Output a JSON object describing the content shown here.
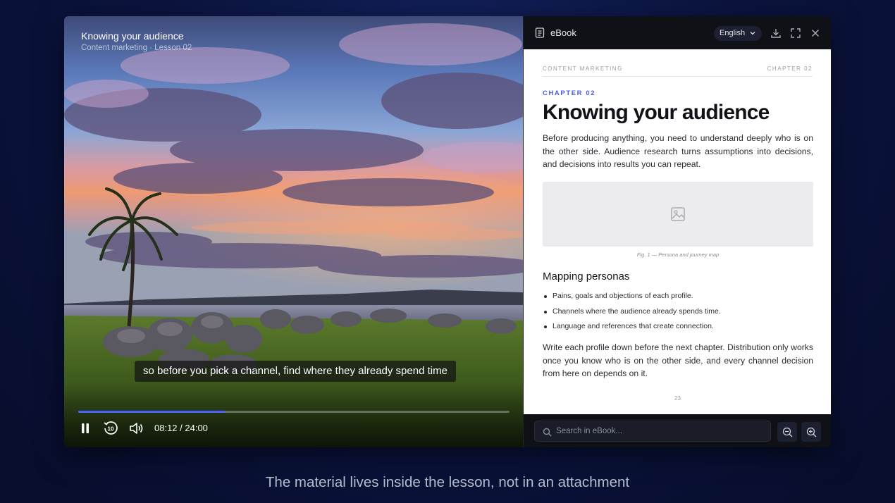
{
  "video": {
    "title": "Knowing your audience",
    "subtitle": "Content marketing · Lesson 02",
    "caption": "so before you pick a channel, find where they already spend time",
    "time": "08:12 / 24:00",
    "progress_fraction": 0.34,
    "controls": [
      "pause-icon",
      "rewind-10-icon",
      "volume-icon"
    ],
    "rewind_label": "10"
  },
  "ebook": {
    "header": {
      "title": "eBook",
      "language": "English",
      "icons": [
        "book-icon",
        "chevron-down-icon",
        "download-icon",
        "fullscreen-icon",
        "close-icon"
      ]
    },
    "page": {
      "running_left": "CONTENT MARKETING",
      "running_right": "CHAPTER 02",
      "kicker": "CHAPTER 02",
      "title": "Knowing your audience",
      "intro": "Before producing anything, you need to understand deeply who is on the other side. Audience research turns assumptions into decisions, and decisions into results you can repeat.",
      "figure_caption": "Fig. 1 — Persona and journey map",
      "section_title": "Mapping personas",
      "bullets": [
        "Pains, goals and objections of each profile.",
        "Channels where the audience already spends time.",
        "Language and references that create connection."
      ],
      "closing": "Write each profile down before the next chapter. Distribution only works once you know who is on the other side, and every channel decision from here on depends on it.",
      "page_number": "23"
    },
    "footer": {
      "search_placeholder": "Search in eBook...",
      "icons": [
        "search-icon",
        "zoom-out-icon",
        "zoom-in-icon"
      ]
    }
  },
  "tagline": "The material lives inside the lesson, not in an attachment",
  "colors": {
    "accent": "#4a63ff",
    "kicker": "#4a5be0",
    "background": "#0b1440"
  }
}
